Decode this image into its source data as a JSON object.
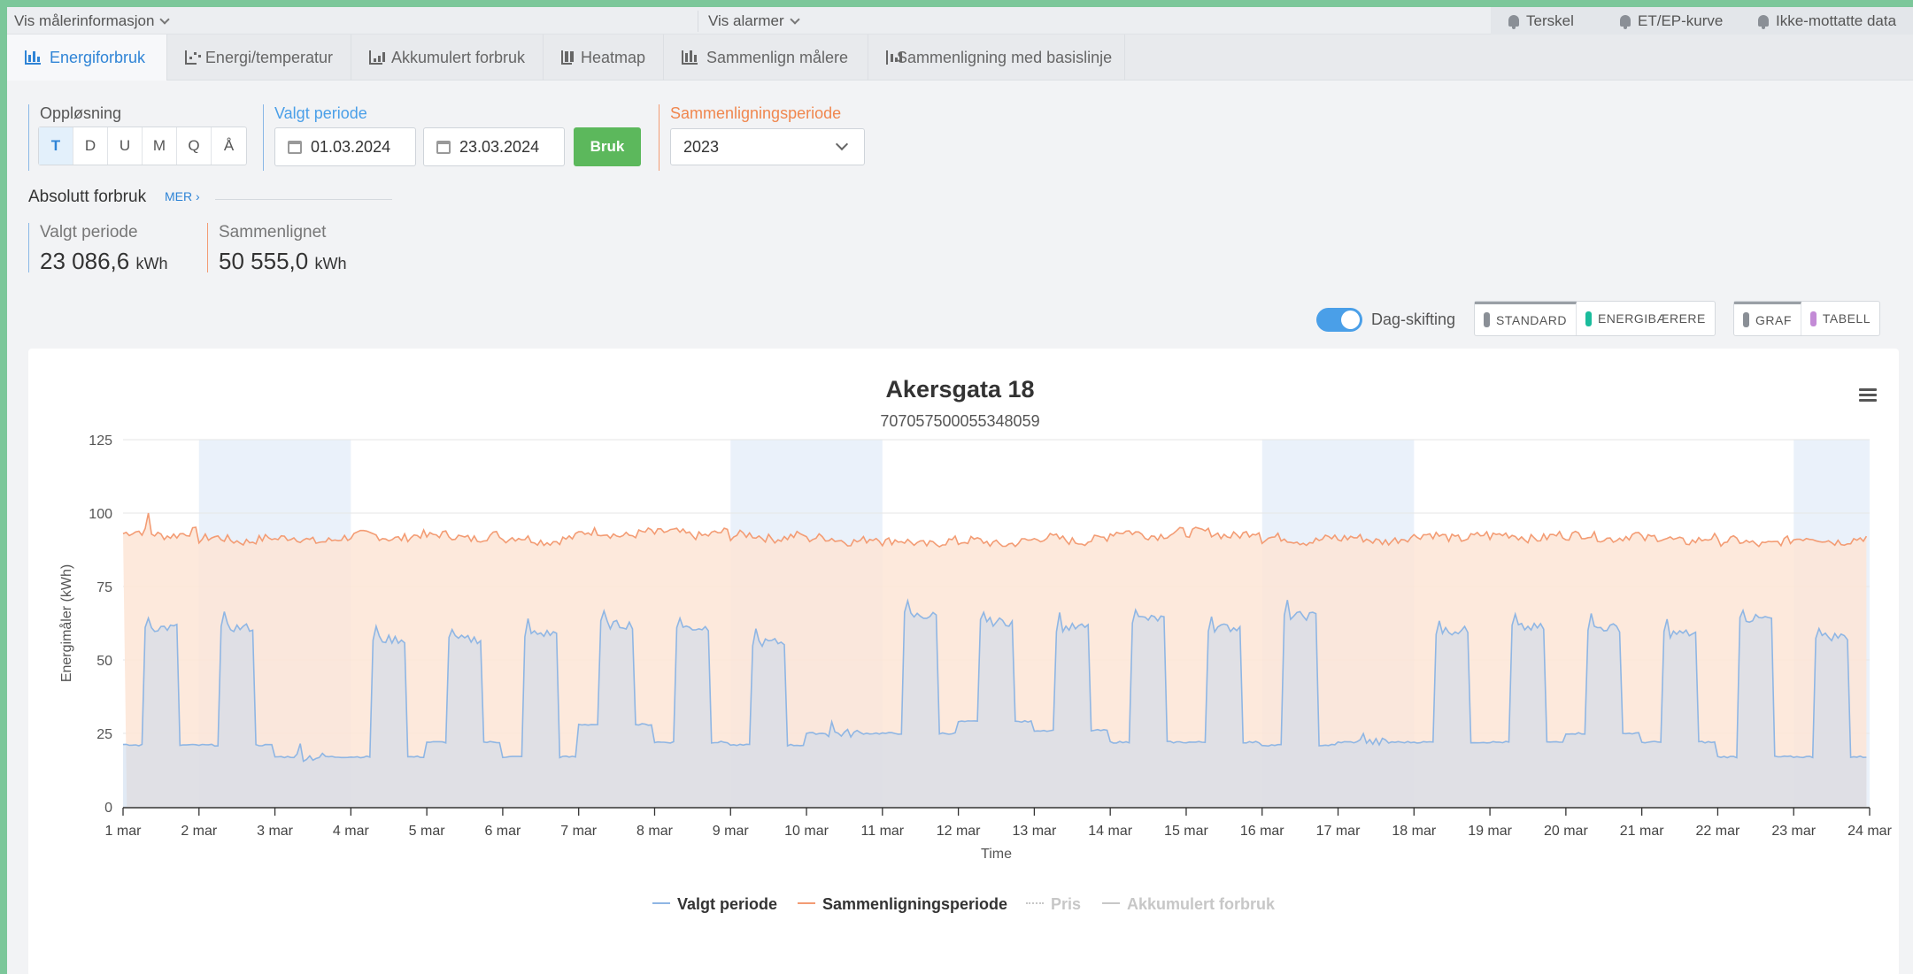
{
  "topbar": {
    "meter_info": "Vis målerinformasjon",
    "alarms": "Vis alarmer",
    "alarm_links": [
      "Terskel",
      "ET/EP-kurve",
      "Ikke-mottatte data"
    ]
  },
  "tabs": [
    {
      "label": "Energiforbruk",
      "icon": "bar-chart-icon",
      "active": true
    },
    {
      "label": "Energi/temperatur",
      "icon": "scatter-chart-icon"
    },
    {
      "label": "Akkumulert forbruk",
      "icon": "line-chart-icon"
    },
    {
      "label": "Heatmap",
      "icon": "heatmap-icon"
    },
    {
      "label": "Sammenlign målere",
      "icon": "bar-chart-icon"
    },
    {
      "label": "Sammenligning med basislinje",
      "icon": "line-chart-icon"
    }
  ],
  "resolution": {
    "label": "Oppløsning",
    "options": [
      "T",
      "D",
      "U",
      "M",
      "Q",
      "Å"
    ],
    "selected": "T"
  },
  "period": {
    "label": "Valgt periode",
    "from": "01.03.2024",
    "to": "23.03.2024",
    "apply": "Bruk"
  },
  "comparison": {
    "label": "Sammenligningsperiode",
    "value": "2023"
  },
  "absolute": {
    "title": "Absolutt forbruk",
    "more": "MER ›",
    "selected_label": "Valgt periode",
    "selected_value": "23 086,6",
    "compared_label": "Sammenlignet",
    "compared_value": "50 555,0",
    "unit": "kWh"
  },
  "view_controls": {
    "day_shift": "Dag-skifting",
    "day_shift_on": true,
    "mode_buttons": [
      {
        "label": "STANDARD",
        "color": "#8a8f96",
        "active": true
      },
      {
        "label": "ENERGIBÆRERE",
        "color": "#1abc9c"
      }
    ],
    "view_buttons": [
      {
        "label": "GRAF",
        "color": "#8a8f96",
        "active": true
      },
      {
        "label": "TABELL",
        "color": "#c38bd6"
      }
    ]
  },
  "colors": {
    "selected": "#8fb6e4",
    "selected_fill": "#c9d8ec",
    "comparison": "#f39c74",
    "comparison_fill": "#fde5d6",
    "weekend_band": "#eaf1fa",
    "accent": "#2f84d6",
    "apply": "#5cb85c"
  },
  "chart_data": {
    "type": "area",
    "title": "Akersgata 18",
    "subtitle": "707057500055348059",
    "xlabel": "Time",
    "ylabel": "Energimåler (kWh)",
    "ylim": [
      0,
      125
    ],
    "yticks": [
      0,
      25,
      50,
      75,
      100,
      125
    ],
    "x_ticks": [
      "1 mar",
      "2 mar",
      "3 mar",
      "4 mar",
      "5 mar",
      "6 mar",
      "7 mar",
      "8 mar",
      "9 mar",
      "10 mar",
      "11 mar",
      "12 mar",
      "13 mar",
      "14 mar",
      "15 mar",
      "16 mar",
      "17 mar",
      "18 mar",
      "19 mar",
      "20 mar",
      "21 mar",
      "22 mar",
      "23 mar",
      "24 mar"
    ],
    "weekend_bands": [
      [
        "2 mar",
        "4 mar"
      ],
      [
        "9 mar",
        "11 mar"
      ],
      [
        "16 mar",
        "18 mar"
      ],
      [
        "23 mar",
        "24 mar"
      ]
    ],
    "grid": true,
    "series": [
      {
        "name": "Valgt periode",
        "daily": [
          {
            "date": "1 mar",
            "night": 21,
            "day": 61
          },
          {
            "date": "2 mar",
            "night": 21,
            "day": 61
          },
          {
            "date": "3 mar",
            "night": 17,
            "day": 17
          },
          {
            "date": "4 mar",
            "night": 17,
            "day": 57
          },
          {
            "date": "5 mar",
            "night": 22,
            "day": 57
          },
          {
            "date": "6 mar",
            "night": 17,
            "day": 59
          },
          {
            "date": "7 mar",
            "night": 28,
            "day": 62
          },
          {
            "date": "8 mar",
            "night": 22,
            "day": 61
          },
          {
            "date": "9 mar",
            "night": 21,
            "day": 56
          },
          {
            "date": "10 mar",
            "night": 25,
            "day": 25
          },
          {
            "date": "11 mar",
            "night": 25,
            "day": 65
          },
          {
            "date": "12 mar",
            "night": 29,
            "day": 63
          },
          {
            "date": "13 mar",
            "night": 26,
            "day": 61
          },
          {
            "date": "14 mar",
            "night": 22,
            "day": 64
          },
          {
            "date": "15 mar",
            "night": 22,
            "day": 61
          },
          {
            "date": "16 mar",
            "night": 21,
            "day": 65
          },
          {
            "date": "17 mar",
            "night": 22,
            "day": 22
          },
          {
            "date": "18 mar",
            "night": 22,
            "day": 60
          },
          {
            "date": "19 mar",
            "night": 22,
            "day": 61
          },
          {
            "date": "20 mar",
            "night": 25,
            "day": 61
          },
          {
            "date": "21 mar",
            "night": 22,
            "day": 59
          },
          {
            "date": "22 mar",
            "night": 17,
            "day": 64
          },
          {
            "date": "23 mar",
            "night": 17,
            "day": 58
          }
        ]
      },
      {
        "name": "Sammenligningsperiode",
        "daily_avg": [
          93,
          91,
          91,
          92,
          92,
          91,
          93,
          93,
          92,
          91,
          90,
          90,
          91,
          93,
          93,
          91,
          91,
          92,
          92,
          92,
          91,
          90,
          91
        ]
      }
    ]
  },
  "legend": [
    {
      "label": "Valgt periode",
      "color": "#8fb6e4",
      "active": true
    },
    {
      "label": "Sammenligningsperiode",
      "color": "#f39c74",
      "active": true
    },
    {
      "label": "Pris",
      "color": "#c7c7c7",
      "active": false
    },
    {
      "label": "Akkumulert forbruk",
      "color": "#c7c7c7",
      "active": false
    }
  ]
}
